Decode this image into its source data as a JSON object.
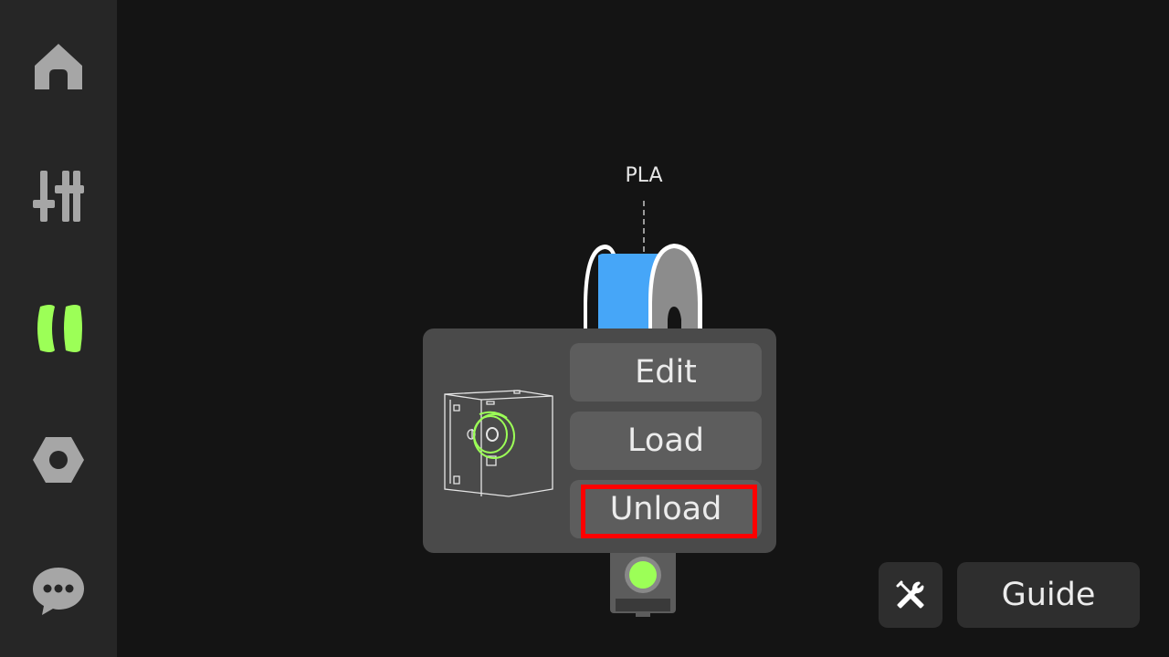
{
  "sidebar": {
    "items": [
      {
        "icon": "home-icon",
        "active": false
      },
      {
        "icon": "sliders-icon",
        "active": false
      },
      {
        "icon": "filament-icon",
        "active": true
      },
      {
        "icon": "hex-nut-settings-icon",
        "active": false
      },
      {
        "icon": "chat-bubble-icon",
        "active": false
      }
    ],
    "active_color": "#9cff57",
    "inactive_color": "#a6a6a6"
  },
  "spool": {
    "material": "PLA",
    "color": "#46a6f8"
  },
  "popup": {
    "edit_label": "Edit",
    "load_label": "Load",
    "unload_label": "Unload",
    "highlighted": "Unload"
  },
  "footer": {
    "tools_icon": "wrench-screwdriver-icon",
    "guide_label": "Guide"
  },
  "colors": {
    "accent": "#9cff57",
    "highlight": "#ff0000",
    "background": "#141414",
    "sidebar": "#262626"
  }
}
